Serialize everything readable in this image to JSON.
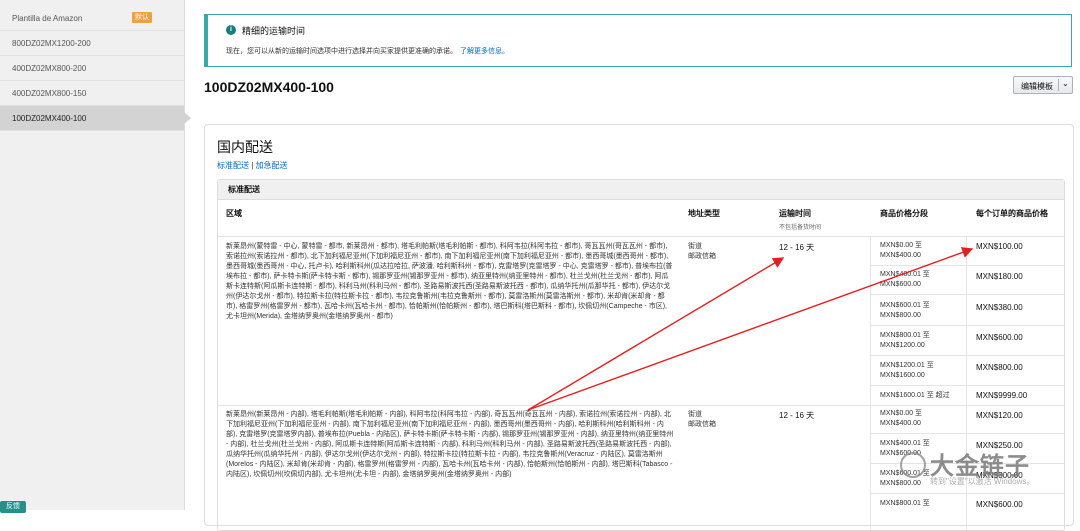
{
  "sidebar": {
    "items": [
      {
        "label": "Plantilla de Amazon",
        "badge": "默认"
      },
      {
        "label": "800DZ02MX1200-200"
      },
      {
        "label": "400DZ02MX800-200"
      },
      {
        "label": "400DZ02MX800-150"
      },
      {
        "label": "100DZ02MX400-100"
      }
    ],
    "feedback": "反馈"
  },
  "info": {
    "title": "精细的运输时间",
    "text": "现在，您可以从新的运输时间选项中进行选择并向买家提供更准确的承诺。",
    "link": "了解更多信息。"
  },
  "page_title": "100DZ02MX400-100",
  "edit_button": "编辑模板",
  "section": {
    "title": "国内配送",
    "link_standard": "标准配送",
    "link_sep": "|",
    "link_expedited": "加急配送",
    "table_caption": "标准配送"
  },
  "columns": {
    "region": "区域",
    "address_type": "地址类型",
    "transit": "运输时间",
    "transit_sub": "不包括备货时间",
    "price_band": "商品价格分段",
    "per_order": "每个订单的商品价格"
  },
  "rows": [
    {
      "region": "新莱昂州(蒙特雷 - 中心, 蒙特雷 - 都市, 新莱昂州 - 都市), 塔毛利帕斯(塔毛利帕斯 - 都市), 科阿韦拉(科阿韦拉 - 都市), 哥瓦瓦州(哥瓦瓦州 - 都市), 索诺拉州(索诺拉州 - 都市), 北下加利福尼亚州(下加利福尼亚州 - 都市), 南下加利福尼亚州(南下加利福尼亚州 - 都市), 墨西哥城(墨西哥州 - 都市), 墨西哥城(墨西哥州 - 中心, 托卢卡), 哈利斯科州(瓜达拉哈拉, 萨波潘, 哈利斯科州 - 都市), 克雷塔罗(克雷塔罗 - 中心, 克雷塔罗 - 都市), 普埃布拉(普埃布拉 - 都市), 萨卡特卡斯(萨卡特卡斯 - 都市), 锡那罗亚州(锡那罗亚州 - 都市), 纳亚里特州(纳亚里特州 - 都市), 杜兰戈州(杜兰戈州 - 都市), 阿瓜斯卡连特斯(阿瓜斯卡连特斯 - 都市), 科利马州(科利马州 - 都市), 圣路易斯波托西(圣路易斯波托西 - 都市), 瓜纳华托州(瓜那华托 - 都市), 伊达尔戈州(伊达尔戈州 - 都市), 特拉斯卡拉(特拉斯卡拉 - 都市), 韦拉克鲁斯州(韦拉克鲁斯州 - 都市), 莫雷洛斯州(莫雷洛斯州 - 都市), 米却肯(米却肯 - 都市), 格雷罗州(格雷罗州 - 都市), 瓦哈卡州(瓦哈卡州 - 都市), 恰帕斯州(恰帕斯州 - 都市), 塔巴斯科(塔巴斯科 - 都市), 坎佩切州(Campeche - 市区), 尤卡坦州(Merida), 金塔纳罗奥州(金塔纳罗奥州 - 都市)",
      "address_type": "街道\n邮政信箱",
      "transit": "12 - 16 天",
      "bands": [
        "MXN$0.00 至\nMXN$400.00",
        "MXN$400.01 至\nMXN$600.00",
        "MXN$600.01 至\nMXN$800.00",
        "MXN$800.01 至\nMXN$1200.00",
        "MXN$1200.01 至\nMXN$1600.00",
        "MXN$1600.01 至 超过"
      ],
      "prices": [
        "MXN$100.00",
        "MXN$180.00",
        "MXN$380.00",
        "MXN$600.00",
        "MXN$800.00",
        "MXN$9999.00"
      ]
    },
    {
      "region": "新莱昂州(新莱昂州 - 内部), 塔毛利帕斯(塔毛利帕斯 - 内部), 科阿韦拉(科阿韦拉 - 内部), 奇瓦瓦州(奇瓦瓦州 - 内部), 索诺拉州(索诺拉州 - 内部), 北下加利福尼亚州(下加利福尼亚州 - 内部), 南下加利福尼亚州(南下加利福尼亚州 - 内部), 墨西哥州(墨西哥州 - 内部), 哈利斯科州(哈利斯科州 - 内部), 克雷塔罗(克雷塔罗内部), 普埃布拉(Puebla - 内陆区), 萨卡特卡斯(萨卡特卡斯 - 内部), 锡那罗亚州(锡那罗亚州 - 内部), 纳亚里特州(纳亚里特州 - 内部), 杜兰戈州(杜兰戈州 - 内部), 阿瓜斯卡连特斯(阿瓜斯卡连特斯 - 内部), 科利马州(科利马州 - 内部), 圣路易斯波托西(圣路易斯波托西 - 内部), 瓜纳华托州(瓜纳华托州 - 内部), 伊达尔戈州(伊达尔戈州 - 内部), 特拉斯卡拉(特拉斯卡拉 - 内部), 韦拉克鲁斯州(Veracruz - 内陆区), 莫雷洛斯州(Morelos - 内陆区), 米却肯(米却肯 - 内部), 格雷罗州(格雷罗州 - 内部), 瓦哈卡州(瓦哈卡州 - 内部), 恰帕斯州(恰帕斯州 - 内部), 塔巴斯科(Tabasco - 内陆区), 坎佩切州(坎佩切内部), 尤卡坦州(尤卡坦 - 内部), 金塔纳罗奥州(金塔纳罗奥州 - 内部)",
      "address_type": "街道\n邮政信箱",
      "transit": "12 - 16 天",
      "bands": [
        "MXN$0.00 至\nMXN$400.00",
        "MXN$400.01 至\nMXN$600.00",
        "MXN$600.01 至\nMXN$800.00",
        "MXN$800.01 至"
      ],
      "prices": [
        "MXN$120.00",
        "MXN$250.00",
        "MXN$300.00",
        "MXN$600.00"
      ]
    }
  ],
  "watermark": {
    "main": "大金链子",
    "sub": "转到\"设置\"以激活 Windows。"
  },
  "colors": {
    "accent": "#3aa8a8",
    "arrow": "#e32020",
    "link": "#0066c0",
    "badge": "#f0a040"
  }
}
